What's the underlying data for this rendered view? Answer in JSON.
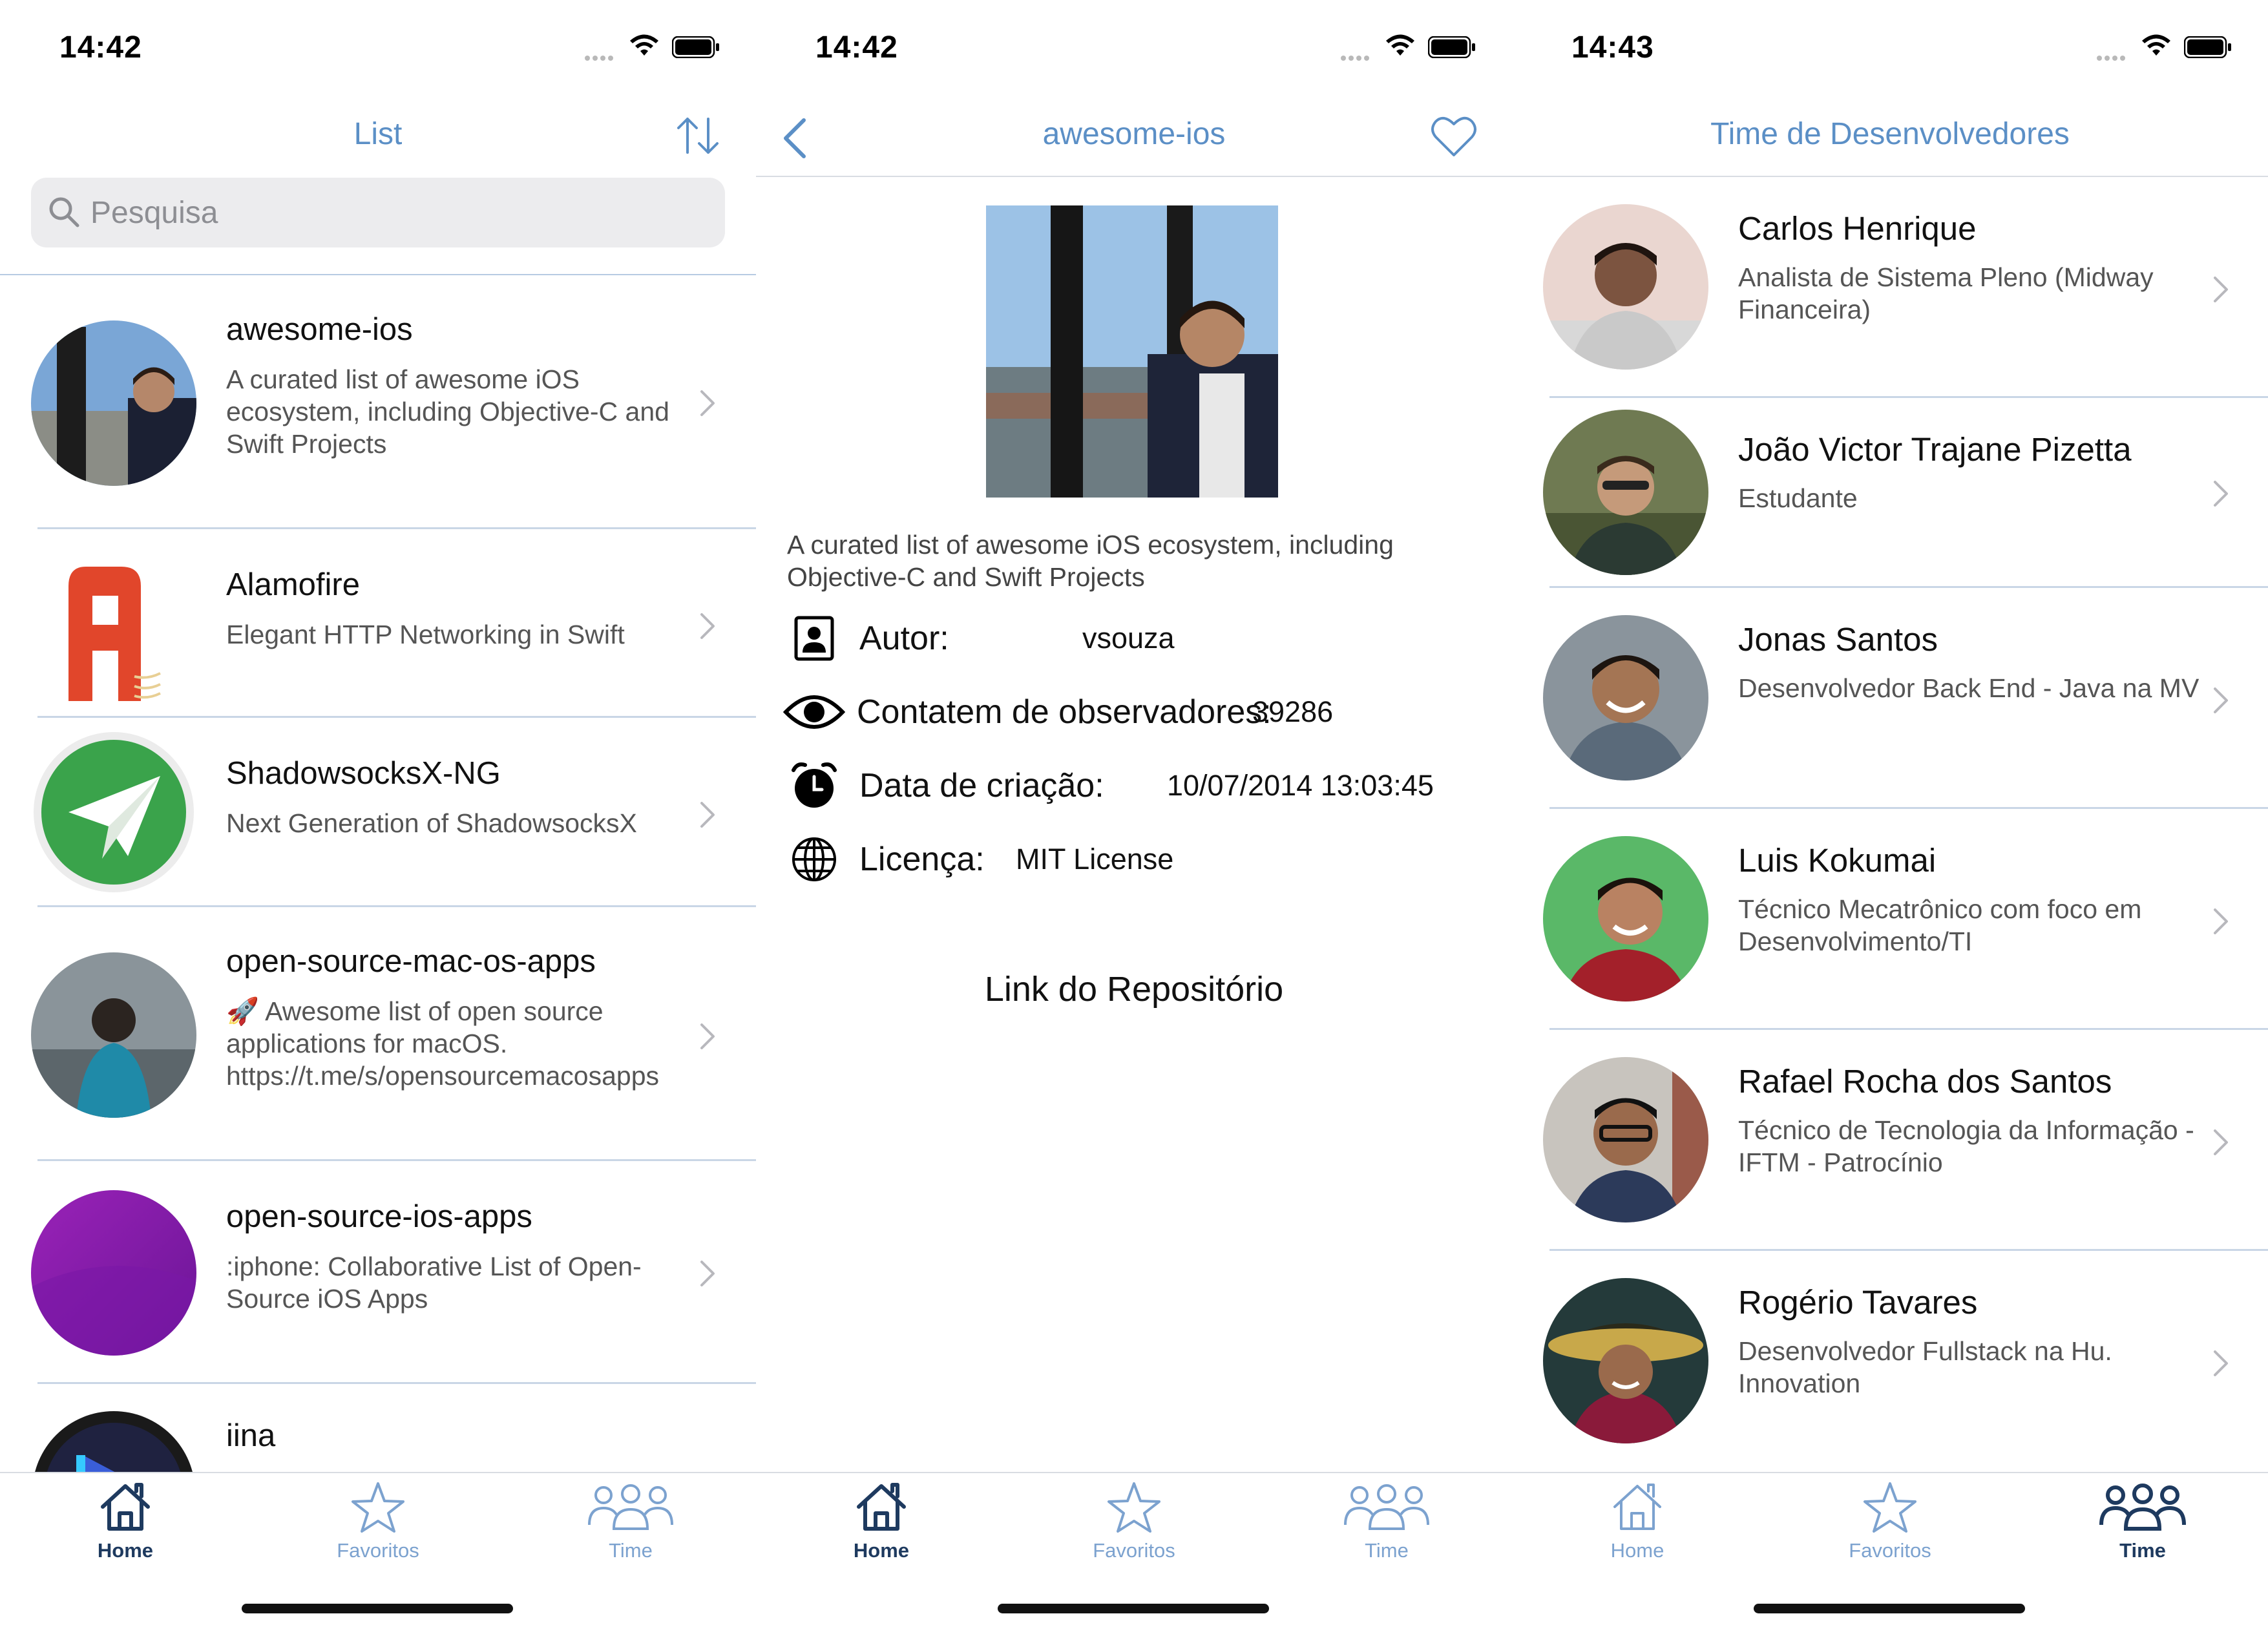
{
  "screens": [
    {
      "status_time": "14:42",
      "nav_title": "List",
      "search_placeholder": "Pesquisa",
      "repos": [
        {
          "name": "awesome-ios",
          "description": "A curated list of awesome iOS ecosystem, including Objective-C and Swift Projects"
        },
        {
          "name": "Alamofire",
          "description": "Elegant HTTP Networking in Swift"
        },
        {
          "name": "ShadowsocksX-NG",
          "description": "Next Generation of ShadowsocksX"
        },
        {
          "name": "open-source-mac-os-apps",
          "description": "🚀 Awesome list of open source applications for macOS. https://t.me/s/opensourcemacosapps"
        },
        {
          "name": "open-source-ios-apps",
          "description": ":iphone: Collaborative List of Open-Source iOS Apps"
        },
        {
          "name": "iina",
          "description": ""
        }
      ]
    },
    {
      "status_time": "14:42",
      "nav_title": "awesome-ios",
      "description": "A curated list of awesome iOS ecosystem, including Objective-C and Swift Projects",
      "author_label": "Autor:",
      "author_value": "vsouza",
      "watchers_label": "Contatem de observadores:",
      "watchers_value": "39286",
      "created_label": "Data de criação:",
      "created_value": "10/07/2014 13:03:45",
      "license_label": "Licença:",
      "license_value": "MIT License",
      "repo_link": "Link do Repositório"
    },
    {
      "status_time": "14:43",
      "nav_title": "Time de Desenvolvedores",
      "members": [
        {
          "name": "Carlos Henrique",
          "role": "Analista de Sistema Pleno (Midway Financeira)"
        },
        {
          "name": "João Victor Trajane Pizetta",
          "role": "Estudante"
        },
        {
          "name": "Jonas Santos",
          "role": "Desenvolvedor Back End - Java na MV"
        },
        {
          "name": "Luis Kokumai",
          "role": "Técnico Mecatrônico com foco em Desenvolvimento/TI"
        },
        {
          "name": "Rafael Rocha dos Santos",
          "role": "Técnico de Tecnologia da Informação - IFTM - Patrocínio"
        },
        {
          "name": "Rogério Tavares",
          "role": "Desenvolvedor Fullstack na Hu. Innovation"
        }
      ]
    }
  ],
  "tabbar": {
    "home": "Home",
    "favorites": "Favoritos",
    "team": "Time"
  },
  "colors": {
    "accent": "#5b8fc6",
    "tab_active": "#1e3a5f",
    "tab_inactive": "#7ca2cf"
  },
  "icons": [
    "sort-icon",
    "search-icon",
    "back-icon",
    "heart-icon",
    "person-icon",
    "eye-icon",
    "alarm-icon",
    "globe-icon",
    "home-icon",
    "star-icon",
    "team-icon",
    "chevron-right-icon"
  ]
}
